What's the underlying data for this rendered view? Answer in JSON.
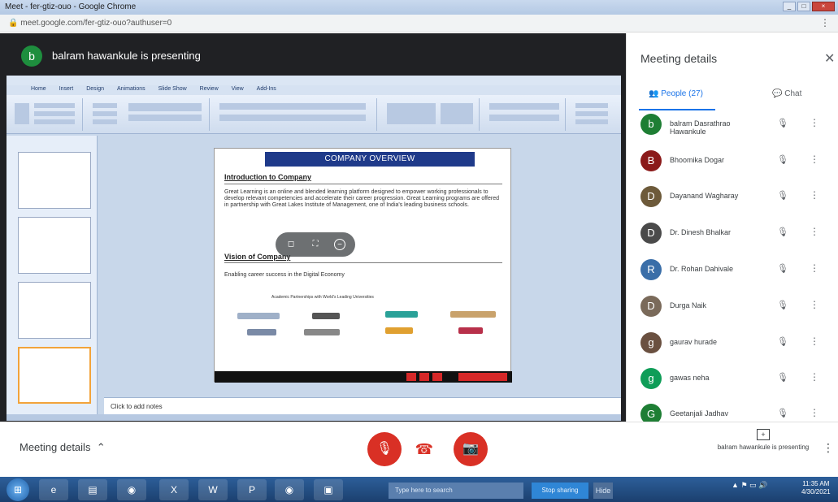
{
  "browser": {
    "title": "Meet - fer-gtiz-ouo - Google Chrome",
    "url": "meet.google.com/fer-gtiz-ouo?authuser=0",
    "menu_icon": "more-vert-icon"
  },
  "meet": {
    "presenter_initial": "b",
    "presenter_text": "balram hawankule is presenting",
    "bottom": {
      "meeting_details": "Meeting details",
      "present_label": "balram hawankule is presenting"
    },
    "panel": {
      "title": "Meeting details",
      "people_tab": "People (27)",
      "chat_tab": "Chat",
      "people": [
        {
          "name": "balram Dasrathrao Hawankule",
          "initial": "b",
          "color": "#1e7e34"
        },
        {
          "name": "Bhoomika Dogar",
          "initial": "B",
          "color": "#8b1a1a"
        },
        {
          "name": "Dayanand Wagharay",
          "initial": "D",
          "color": "#6d5a3a"
        },
        {
          "name": "Dr. Dinesh Bhalkar",
          "initial": "D",
          "color": "#4a4a4a"
        },
        {
          "name": "Dr. Rohan Dahivale",
          "initial": "R",
          "color": "#3a6ea8"
        },
        {
          "name": "Durga Naik",
          "initial": "D",
          "color": "#7a6a5a"
        },
        {
          "name": "gaurav hurade",
          "initial": "g",
          "color": "#6a5040"
        },
        {
          "name": "gawas neha",
          "initial": "g",
          "color": "#0f9d58"
        },
        {
          "name": "Geetanjali Jadhav",
          "initial": "G",
          "color": "#1e7e34"
        }
      ]
    }
  },
  "ppt": {
    "ribbon_tabs": [
      "Home",
      "Insert",
      "Design",
      "Animations",
      "Slide Show",
      "Review",
      "View",
      "Add-Ins"
    ],
    "notes_placeholder": "Click to add notes",
    "slide": {
      "header": "COMPANY OVERVIEW",
      "heading1": "Introduction to Company",
      "body": "Great Learning is an online and blended learning platform designed to empower working professionals to develop relevant competencies and accelerate their career progression. Great Learning programs are offered in partnership with Great Lakes Institute of Management, one of India's leading business schools.",
      "heading2": "Vision of Company",
      "vision": "Enabling career success in the Digital Economy",
      "logos_title": "Academic Partnerships with World's Leading Universities"
    }
  },
  "taskbar": {
    "search_text": "Type here to search",
    "pill_text": "Stop sharing",
    "time": "11:35 AM",
    "date": "4/30/2021"
  }
}
